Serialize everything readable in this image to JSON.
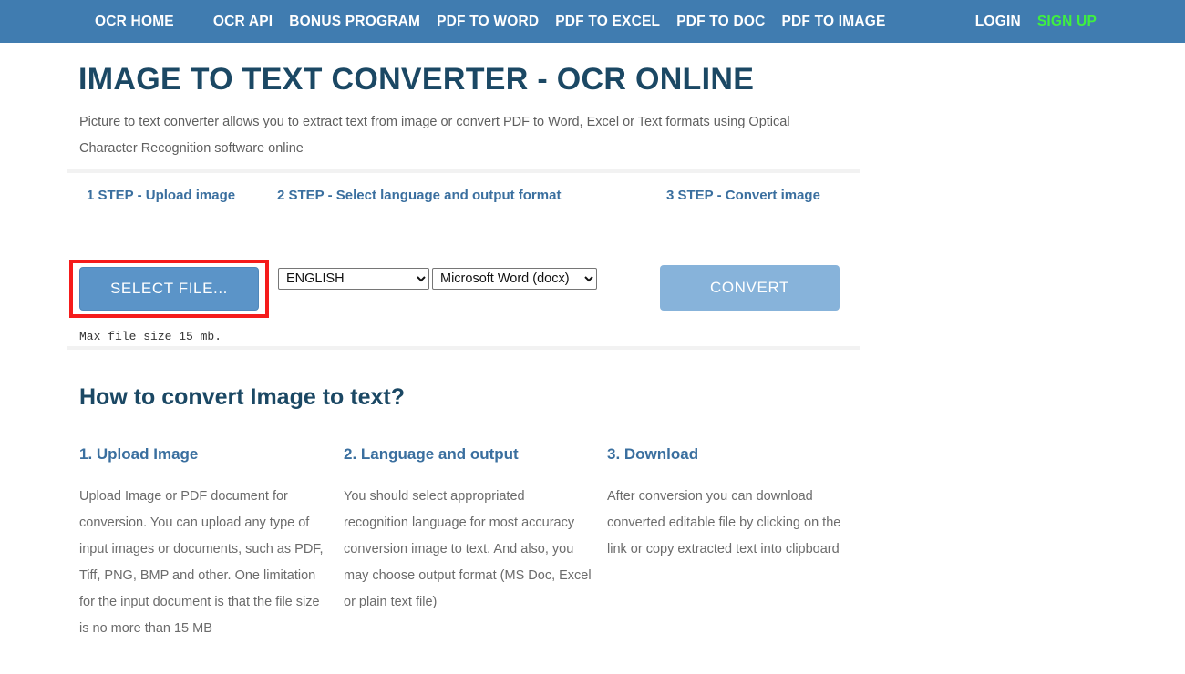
{
  "nav": {
    "left_items": [
      {
        "label": "OCR HOME",
        "name": "nav-ocr-home"
      },
      {
        "label": "OCR API",
        "name": "nav-ocr-api"
      },
      {
        "label": "BONUS PROGRAM",
        "name": "nav-bonus-program"
      },
      {
        "label": "PDF TO WORD",
        "name": "nav-pdf-to-word"
      },
      {
        "label": "PDF TO EXCEL",
        "name": "nav-pdf-to-excel"
      },
      {
        "label": "PDF TO DOC",
        "name": "nav-pdf-to-doc"
      },
      {
        "label": "PDF TO IMAGE",
        "name": "nav-pdf-to-image"
      }
    ],
    "login_label": "LOGIN",
    "signup_label": "SIGN UP",
    "background_color": "#407cb0",
    "signup_color": "#3ff03f"
  },
  "hero": {
    "title": "IMAGE TO TEXT CONVERTER - OCR ONLINE",
    "subtitle": "Picture to text converter allows you to extract text from image or convert PDF to Word, Excel or Text formats using Optical Character Recognition software online",
    "title_color": "#1b4864"
  },
  "steps": {
    "step1_label": "1 STEP - Upload image",
    "step2_label": "2 STEP - Select language and output format",
    "step3_label": "3 STEP - Convert image",
    "select_file_label": "SELECT FILE...",
    "convert_label": "CONVERT",
    "max_file_size": "Max file size 15 mb.",
    "language": {
      "selected": "ENGLISH",
      "options": [
        "ENGLISH"
      ]
    },
    "output_format": {
      "selected": "Microsoft Word (docx)",
      "options": [
        "Microsoft Word (docx)"
      ]
    },
    "highlight_color": "#f51b1b",
    "select_file_color": "#5b94c8",
    "convert_color": "#87b3da"
  },
  "howto": {
    "title": "How to convert Image to text?",
    "columns": [
      {
        "heading": "1. Upload Image",
        "body": "Upload Image or PDF document for conversion. You can upload any type of input images or documents, such as PDF, Tiff, PNG, BMP and other. One limitation for the input document is that the file size is no more than 15 MB"
      },
      {
        "heading": "2. Language and output",
        "body": "You should select appropriated recognition language for most accuracy conversion image to text. And also, you may choose output format (MS Doc, Excel or plain text file)"
      },
      {
        "heading": "3. Download",
        "body": "After conversion you can download converted editable file by clicking on the link or copy extracted text into clipboard"
      }
    ]
  }
}
